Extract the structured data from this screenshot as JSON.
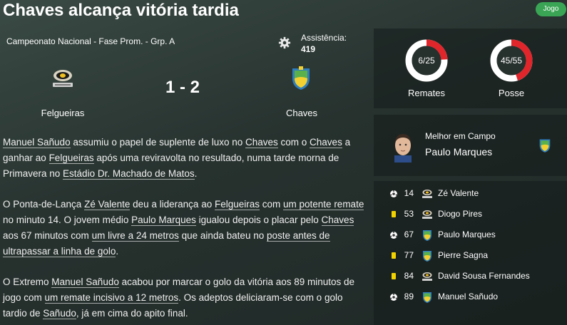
{
  "header": {
    "title": "Chaves alcança vitória tardia",
    "badge": "Jogo"
  },
  "match": {
    "competition": "Campeonato Nacional - Fase Prom. - Grp. A",
    "attendance_label": "Assistência:",
    "attendance_value": "419",
    "home_team": "Felgueiras",
    "away_team": "Chaves",
    "score": "1 - 2"
  },
  "stats": {
    "shots": {
      "label": "Remates",
      "value": "6/25",
      "fraction": 0.24
    },
    "possession": {
      "label": "Posse",
      "value": "45/55",
      "fraction": 0.45
    }
  },
  "best_player": {
    "label": "Melhor em Campo",
    "name": "Paulo Marques"
  },
  "events": [
    {
      "type": "goal",
      "minute": "14",
      "team": "home",
      "player": "Zé Valente"
    },
    {
      "type": "yellow",
      "minute": "53",
      "team": "home",
      "player": "Diogo Pires"
    },
    {
      "type": "goal",
      "minute": "67",
      "team": "away",
      "player": "Paulo Marques"
    },
    {
      "type": "yellow",
      "minute": "77",
      "team": "away",
      "player": "Pierre Sagna"
    },
    {
      "type": "yellow",
      "minute": "84",
      "team": "home",
      "player": "David Sousa Fernandes"
    },
    {
      "type": "goal",
      "minute": "89",
      "team": "away",
      "player": "Manuel Sañudo"
    }
  ],
  "report": {
    "p1": {
      "t1": "Manuel Sañudo",
      "t2": " assumiu o papel de suplente de luxo no ",
      "t3": "Chaves",
      "t4": " com o ",
      "t5": "Chaves",
      "t6": " a ganhar ao ",
      "t7": "Felgueiras",
      "t8": " após uma reviravolta no resultado, numa tarde morna de Primavera no ",
      "t9": "Estádio Dr. Machado de Matos",
      "t10": "."
    },
    "p2": {
      "t1": "O Ponta-de-Lança ",
      "t2": "Zé Valente",
      "t3": " deu a liderança ao ",
      "t4": "Felgueiras",
      "t5": " com ",
      "t6": "um potente remate",
      "t7": " no minuto 14. O jovem médio ",
      "t8": "Paulo Marques",
      "t9": " igualou depois o placar pelo ",
      "t10": "Chaves",
      "t11": " aos 67 minutos com ",
      "t12": "um livre a 24 metros",
      "t13": " que ainda bateu no ",
      "t14": "poste antes de ultrapassar a linha de golo",
      "t15": "."
    },
    "p3": {
      "t1": "O Extremo ",
      "t2": "Manuel Sañudo",
      "t3": " acabou por marcar o golo da vitória aos 89 minutos de jogo com ",
      "t4": "um remate incisivo a 12 metros",
      "t5": ". Os adeptos deliciaram-se com o golo tardio de ",
      "t6": "Sañudo",
      "t7": ", já em cima do apito final."
    }
  },
  "colors": {
    "accent_green": "#3aa655",
    "donut_red": "#e0252b",
    "card_yellow": "#f2d300"
  }
}
